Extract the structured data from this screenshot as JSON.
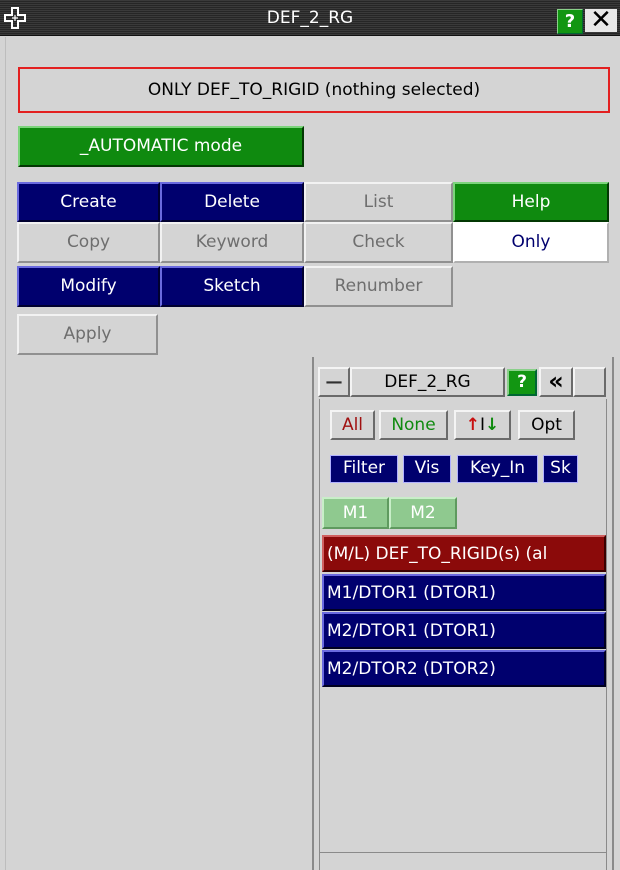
{
  "window": {
    "title": "DEF_2_RG",
    "help_label": "?",
    "close_label": "✕"
  },
  "status": {
    "text": "ONLY DEF_TO_RIGID (nothing selected)",
    "border_color": "#e32020"
  },
  "mode_button": {
    "label": "_AUTOMATIC mode"
  },
  "action_grid": [
    [
      {
        "label": "Create",
        "state": "active"
      },
      {
        "label": "Delete",
        "state": "active"
      },
      {
        "label": "List",
        "state": "disabled"
      },
      {
        "label": "Help",
        "state": "green"
      }
    ],
    [
      {
        "label": "Copy",
        "state": "disabled"
      },
      {
        "label": "Keyword",
        "state": "disabled"
      },
      {
        "label": "Check",
        "state": "disabled"
      },
      {
        "label": "Only",
        "state": "selected"
      }
    ],
    [
      {
        "label": "Modify",
        "state": "active"
      },
      {
        "label": "Sketch",
        "state": "active"
      },
      {
        "label": "Renumber",
        "state": "disabled"
      }
    ]
  ],
  "apply_label": "Apply",
  "selector": {
    "title": "DEF_2_RG",
    "minimize_label": "—",
    "help_label": "?",
    "collapse_label": "«",
    "row1": {
      "all": "All",
      "none": "None",
      "reverse_up": "↑",
      "reverse_sep": "I",
      "reverse_down": "↓",
      "opt": "Opt"
    },
    "row2": {
      "filter": "Filter",
      "vis": "Vis",
      "key_in": "Key_In",
      "sk": "Sk"
    },
    "models": [
      "M1",
      "M2"
    ],
    "list_items": [
      {
        "label": "(M/L) DEF_TO_RIGID(s) (al",
        "color": "#8b0a0a"
      },
      {
        "label": "M1/DTOR1 (DTOR1)",
        "color": "#00006e"
      },
      {
        "label": "M2/DTOR1 (DTOR1)",
        "color": "#00006e"
      },
      {
        "label": "M2/DTOR2 (DTOR2)",
        "color": "#00006e"
      }
    ]
  },
  "colors": {
    "active_blue": "#00006e",
    "green": "#0f8a0f",
    "disabled_text": "#6e6e6e",
    "header_red": "#8b0a0a"
  }
}
